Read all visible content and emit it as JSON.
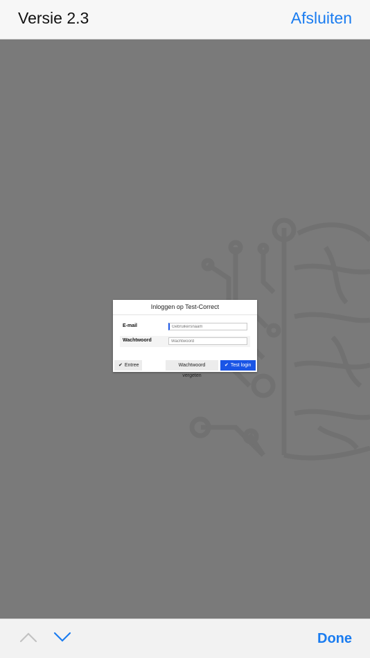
{
  "topbar": {
    "title": "Versie 2.3",
    "close_label": "Afsluiten"
  },
  "dialog": {
    "title": "Inloggen op Test-Correct",
    "email_label": "E-mail",
    "email_placeholder": "Gebruikersnaam",
    "password_label": "Wachtwoord",
    "password_placeholder": "Wachtwoord",
    "entree_label": "Entree",
    "forgot_label": "Wachtwoord vergeten",
    "test_login_label": "Test login"
  },
  "bottombar": {
    "done_label": "Done"
  },
  "icons": {
    "up": "chevron-up-icon",
    "down": "chevron-down-icon",
    "check": "checkmark-icon",
    "background": "brain-circuit-icon"
  },
  "colors": {
    "accent": "#1a7cf0",
    "button_primary": "#1a55e6",
    "backdrop": "#7a7a7a"
  }
}
